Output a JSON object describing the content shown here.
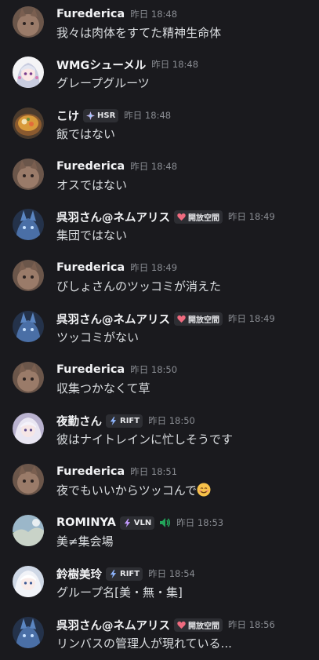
{
  "messages": [
    {
      "name": "Furederica",
      "time": "昨日 18:48",
      "text": "我々は肉体をすてた精神生命体"
    },
    {
      "name": "WMGシューメル",
      "time": "昨日 18:48",
      "text": "グレープグルーツ"
    },
    {
      "name": "こけ",
      "tag": "HSR",
      "time": "昨日 18:48",
      "text": "飯ではない"
    },
    {
      "name": "Furederica",
      "time": "昨日 18:48",
      "text": "オスではない"
    },
    {
      "name": "呉羽さん@ネムアリス",
      "tag": "開放空間",
      "time": "昨日 18:49",
      "text": "集団ではない"
    },
    {
      "name": "Furederica",
      "time": "昨日 18:49",
      "text": "びしょさんのツッコミが消えた"
    },
    {
      "name": "呉羽さん@ネムアリス",
      "tag": "開放空間",
      "time": "昨日 18:49",
      "text": "ツッコミがない"
    },
    {
      "name": "Furederica",
      "time": "昨日 18:50",
      "text": "収集つかなくて草"
    },
    {
      "name": "夜勤さん",
      "tag": "RIFT",
      "time": "昨日 18:50",
      "text": "彼はナイトレインに忙しそうです"
    },
    {
      "name": "Furederica",
      "time": "昨日 18:51",
      "text": "夜でもいいからツッコんで"
    },
    {
      "name": "ROMINYA",
      "tag": "VLN",
      "time": "昨日 18:53",
      "text": "美≠集会場"
    },
    {
      "name": "鈴樹美玲",
      "tag": "RIFT",
      "time": "昨日 18:54",
      "text": "グループ名[美・無・集]"
    },
    {
      "name": "呉羽さん@ネムアリス",
      "tag": "開放空間",
      "time": "昨日 18:56",
      "text": "リンバスの管理人が現れている..."
    }
  ],
  "icons": {
    "avatars": [
      "cat-avatar",
      "anime-girl-avatar",
      "food-bowl-avatar",
      "cat-avatar",
      "blue-creature-avatar",
      "cat-avatar",
      "blue-creature-avatar",
      "cat-avatar",
      "white-hair-avatar",
      "cat-avatar",
      "landscape-avatar",
      "white-hair-avatar",
      "blue-creature-avatar"
    ],
    "tags": {
      "HSR": "star-icon",
      "開放空間": "heart-icon",
      "RIFT": "lightning-icon",
      "VLN": "lightning-icon"
    },
    "speaker": "speaker-icon",
    "emoji": "smiling-face-icon"
  },
  "colors": {
    "background": "#1a1a1e",
    "name": "#f2f3f5",
    "text": "#dbdee1",
    "timestamp": "#8a8d93",
    "tag_bg": "#2d2e33",
    "speaker_green": "#23a55a"
  }
}
